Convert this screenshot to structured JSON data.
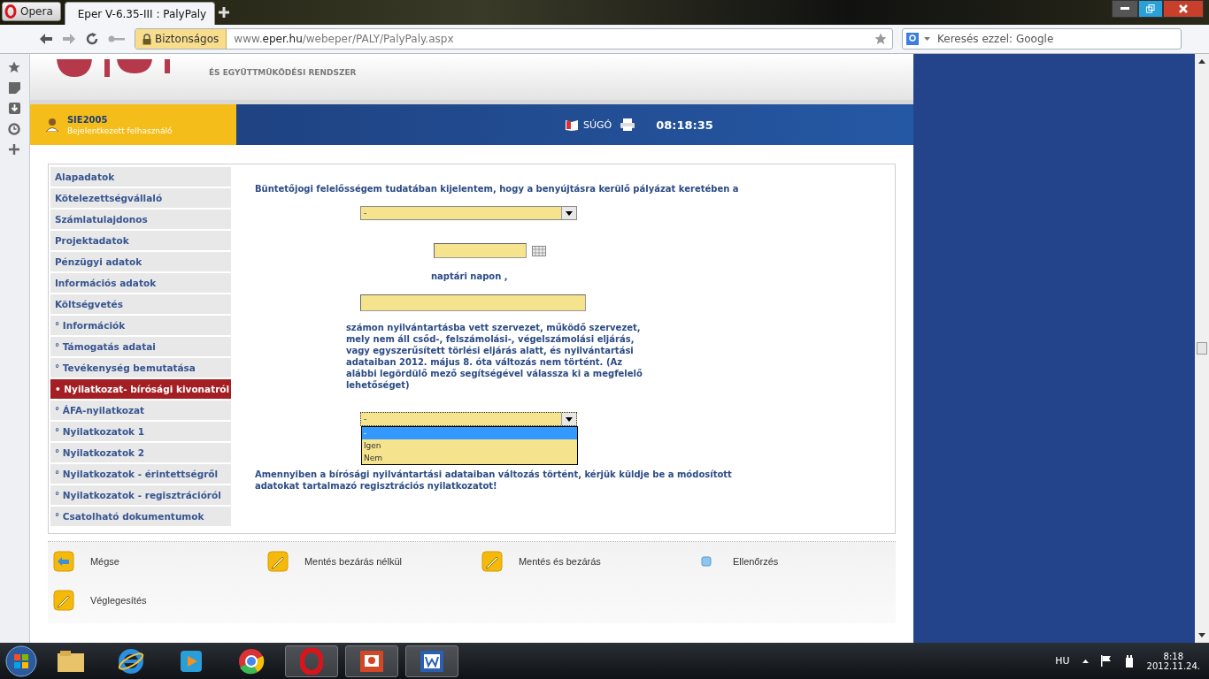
{
  "browser": {
    "opera_button": "Opera",
    "tab": {
      "title": "Eper V-6.35-III : PalyPaly",
      "selected": true
    },
    "security": "Biztonságos",
    "url": "www.**eper.hu**/webeper/PALY/PalyPaly.aspx",
    "search": {
      "placeholder": "Keresés ezzel: Google"
    }
  },
  "header": {
    "logo_subtitle": "ÉS EGYÜTTMŰKÖDÉSI RENDSZER",
    "user": "SIE2005",
    "user_role": "Bejelentkezett felhasználó",
    "help": "SÚGÓ",
    "time": "08:18:35"
  },
  "nav": [
    {
      "label": "Alapadatok",
      "selected": false
    },
    {
      "label": "Kötelezettségvállaló",
      "selected": false
    },
    {
      "label": "Számlatulajdonos",
      "selected": false
    },
    {
      "label": "Projektadatok",
      "selected": false
    },
    {
      "label": "Pénzügyi adatok",
      "selected": false
    },
    {
      "label": "Információs adatok",
      "selected": false
    },
    {
      "label": "Költségvetés",
      "selected": false
    },
    {
      "label": "° Információk",
      "selected": false
    },
    {
      "label": "° Támogatás adatai",
      "selected": false
    },
    {
      "label": "° Tevékenység bemutatása",
      "selected": false
    },
    {
      "label": "• Nyilatkozat- bírósági kivonatról",
      "selected": true
    },
    {
      "label": "° ÁFA-nyilatkozat",
      "selected": false
    },
    {
      "label": "° Nyilatkozatok 1",
      "selected": false
    },
    {
      "label": "° Nyilatkozatok 2",
      "selected": false
    },
    {
      "label": "° Nyilatkozatok - érintettségről",
      "selected": false
    },
    {
      "label": "° Nyilatkozatok - regisztrációról",
      "selected": false
    },
    {
      "label": "° Csatolható dokumentumok",
      "selected": false
    }
  ],
  "form": {
    "intro": "Büntetőjogi felelősségem tudatában kijelentem, hogy a benyújtásra kerülő pályázat keretében a",
    "org_select": {
      "value": "-"
    },
    "day_label": "naptári napon ,",
    "statement": "számon nyilvántartásba vett szervezet, működő szervezet, mely nem áll csőd-, felszámolási-, végelszámolási eljárás, vagy egyszerűsített törlési eljárás alatt, és nyilvántartási adataiban 2012. május 8. óta változás nem történt. (Az alábbi legördülő mező segítségével válassza ki a megfelelő lehetőséget)",
    "change_select": {
      "value": "-",
      "expanded": true,
      "options": [
        {
          "label": "-",
          "selected": true
        },
        {
          "label": "Igen",
          "selected": false
        },
        {
          "label": "Nem",
          "selected": false
        }
      ]
    },
    "note": "Amennyiben a bírósági nyilvántartási adataiban változás történt, kérjük küldje be a módosított adatokat tartalmazó regisztrációs nyilatkozatot!"
  },
  "actions": [
    {
      "label": "Mégse",
      "kind": "back"
    },
    {
      "label": "Mentés bezárás nélkül",
      "kind": "edit"
    },
    {
      "label": "Mentés és bezárás",
      "kind": "edit"
    },
    {
      "label": "Ellenőrzés",
      "kind": "check"
    },
    {
      "label": "Véglegesítés",
      "kind": "edit"
    }
  ],
  "taskbar": {
    "apps": [
      {
        "kind": "folder",
        "active": false
      },
      {
        "kind": "ie",
        "active": false
      },
      {
        "kind": "media",
        "active": false
      },
      {
        "kind": "chrome",
        "active": false
      },
      {
        "kind": "opera",
        "active": true
      },
      {
        "kind": "slides",
        "active": true
      },
      {
        "kind": "word",
        "active": true
      }
    ],
    "language": "HU",
    "time": "8:18",
    "date": "2012.11.24."
  }
}
